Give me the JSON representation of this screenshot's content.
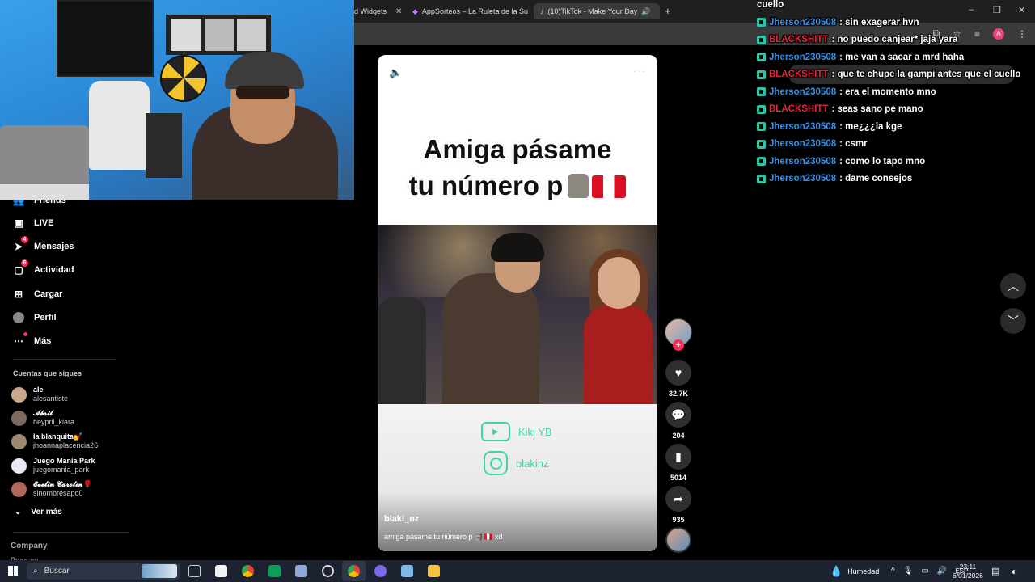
{
  "browser": {
    "tabs": [
      {
        "label": "d Widgets",
        "active": false
      },
      {
        "label": "AppSorteos – La Ruleta de la Su",
        "active": false
      },
      {
        "label": "(10)TikTok - Make Your Day",
        "active": true
      }
    ],
    "new_tab": "+",
    "window_controls": [
      "–",
      "❐",
      "✕"
    ]
  },
  "left_nav": {
    "items": [
      {
        "label": "Friends",
        "icon": "friends-icon"
      },
      {
        "label": "LIVE",
        "icon": "live-icon"
      },
      {
        "label": "Mensajes",
        "icon": "messages-icon",
        "badge": "4"
      },
      {
        "label": "Actividad",
        "icon": "activity-icon",
        "badge": "6"
      },
      {
        "label": "Cargar",
        "icon": "upload-icon"
      },
      {
        "label": "Perfil",
        "icon": "profile-avatar"
      },
      {
        "label": "Más",
        "icon": "more-icon"
      }
    ],
    "following_title": "Cuentas que sigues",
    "following": [
      {
        "name": "ale",
        "handle": "alesantiste"
      },
      {
        "name": "𝓐𝓫𝓻𝓲𝓵",
        "handle": "heypril_kiara"
      },
      {
        "name": "la blanquita💅",
        "handle": "jhoannaplacencia26"
      },
      {
        "name": "Juego Mania Park",
        "handle": "juegomania_park"
      },
      {
        "name": "𝓔𝓿𝓮𝓵𝓲𝓷 𝓒𝓪𝓻𝓸𝓵𝓲𝓷🌹",
        "handle": "sinombresapo0"
      }
    ],
    "see_more": "Ver más",
    "company": "Company",
    "program": "Program"
  },
  "video": {
    "caption_line1": "Amiga pásame",
    "caption_line2": "tu número p",
    "socials": [
      {
        "label": "Kiki YB",
        "icon": "youtube-icon"
      },
      {
        "label": "blakinz",
        "icon": "instagram-icon"
      }
    ],
    "author": "blaki_nz",
    "description": "amiga pásame tu número p 🗿🇵🇪 xd"
  },
  "actions": {
    "likes": "32.7K",
    "comments": "204",
    "saves": "5014",
    "shares": "935"
  },
  "chat": {
    "top_fragment": "cuello",
    "messages": [
      {
        "user": "Jherson230508",
        "color": "#3b8fe0",
        "text": ": sin exagerar hvn"
      },
      {
        "user": "BLACKSHITT",
        "color": "#e0283a",
        "text": ": no puedo canjear* jaja yara"
      },
      {
        "user": "Jherson230508",
        "color": "#3b8fe0",
        "text": ": me van a sacar a mrd haha"
      },
      {
        "user": "BLACKSHITT",
        "color": "#e0283a",
        "text": ": que te chupe la gampi antes que el cuello"
      },
      {
        "user": "Jherson230508",
        "color": "#3b8fe0",
        "text": ": era el momento mno"
      },
      {
        "user": "BLACKSHITT",
        "color": "#e0283a",
        "text": ": seas sano pe mano"
      },
      {
        "user": "Jherson230508",
        "color": "#3b8fe0",
        "text": ": me¿¿¿la kge"
      },
      {
        "user": "Jherson230508",
        "color": "#3b8fe0",
        "text": ": csmr"
      },
      {
        "user": "Jherson230508",
        "color": "#3b8fe0",
        "text": ": como lo tapo mno"
      },
      {
        "user": "Jherson230508",
        "color": "#3b8fe0",
        "text": ": dame consejos"
      }
    ]
  },
  "taskbar": {
    "search_placeholder": "Buscar",
    "weather": "Humedad",
    "language": "ESP",
    "time": "23:11",
    "date": "6/01/2026"
  }
}
